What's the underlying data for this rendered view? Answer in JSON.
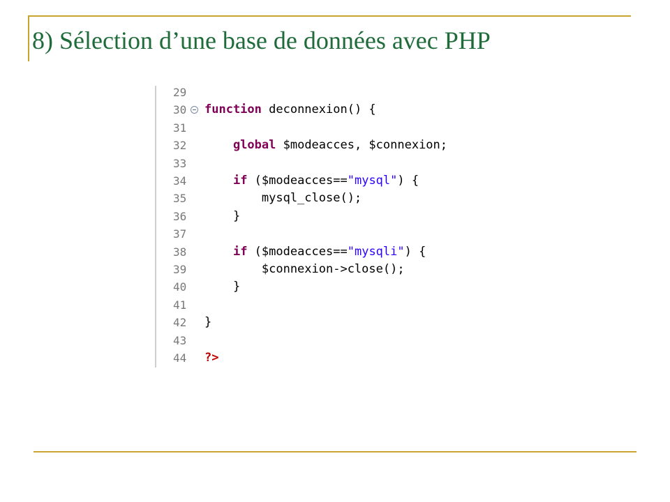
{
  "slide": {
    "title": "8) Sélection d’une base de données avec PHP"
  },
  "code": {
    "lines": [
      {
        "n": "29",
        "tokens": []
      },
      {
        "n": "30",
        "fold": true,
        "tokens": [
          {
            "t": "function",
            "c": "kw"
          },
          {
            "t": " deconnexion() {",
            "c": "plain"
          }
        ]
      },
      {
        "n": "31",
        "tokens": []
      },
      {
        "n": "32",
        "tokens": [
          {
            "t": "    ",
            "c": "plain"
          },
          {
            "t": "global",
            "c": "kw"
          },
          {
            "t": " $modeacces, $connexion;",
            "c": "plain"
          }
        ]
      },
      {
        "n": "33",
        "tokens": []
      },
      {
        "n": "34",
        "tokens": [
          {
            "t": "    ",
            "c": "plain"
          },
          {
            "t": "if",
            "c": "kw"
          },
          {
            "t": " ($modeacces==",
            "c": "plain"
          },
          {
            "t": "\"mysql\"",
            "c": "str"
          },
          {
            "t": ") {",
            "c": "plain"
          }
        ]
      },
      {
        "n": "35",
        "tokens": [
          {
            "t": "        mysql_close();",
            "c": "plain"
          }
        ]
      },
      {
        "n": "36",
        "tokens": [
          {
            "t": "    }",
            "c": "plain"
          }
        ]
      },
      {
        "n": "37",
        "tokens": []
      },
      {
        "n": "38",
        "tokens": [
          {
            "t": "    ",
            "c": "plain"
          },
          {
            "t": "if",
            "c": "kw"
          },
          {
            "t": " ($modeacces==",
            "c": "plain"
          },
          {
            "t": "\"mysqli\"",
            "c": "str"
          },
          {
            "t": ") {",
            "c": "plain"
          }
        ]
      },
      {
        "n": "39",
        "tokens": [
          {
            "t": "        $connexion->close();",
            "c": "plain"
          }
        ]
      },
      {
        "n": "40",
        "tokens": [
          {
            "t": "    }",
            "c": "plain"
          }
        ]
      },
      {
        "n": "41",
        "tokens": []
      },
      {
        "n": "42",
        "tokens": [
          {
            "t": "}",
            "c": "plain"
          }
        ]
      },
      {
        "n": "43",
        "tokens": []
      },
      {
        "n": "44",
        "tokens": [
          {
            "t": "?>",
            "c": "phpend"
          }
        ]
      }
    ]
  },
  "colors": {
    "title": "#1F6B3A",
    "rule": "#C8A52E",
    "keyword": "#7F0055",
    "string": "#2A00FF",
    "php_end": "#C00000",
    "line_number": "#787878"
  }
}
